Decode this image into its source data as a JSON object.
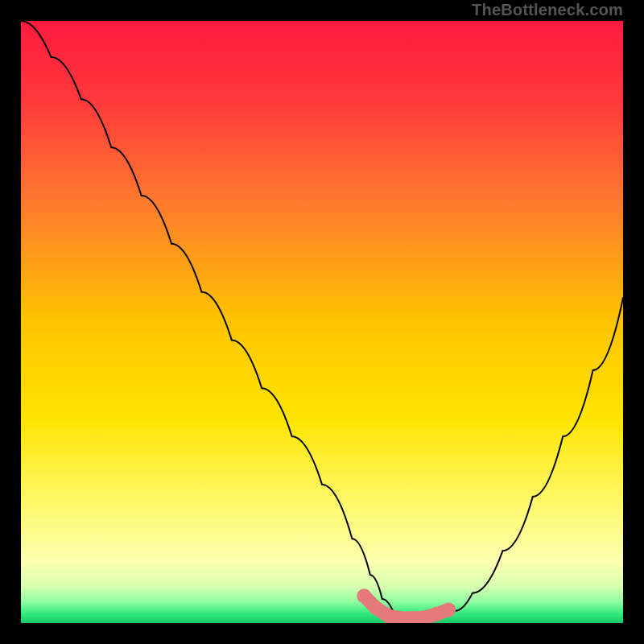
{
  "attribution": "TheBottleneck.com",
  "colors": {
    "frame": "#000000",
    "gradient_stops": [
      {
        "offset": 0,
        "color": "#ff1a3e"
      },
      {
        "offset": 0.14,
        "color": "#ff3b3b"
      },
      {
        "offset": 0.3,
        "color": "#ff7a2e"
      },
      {
        "offset": 0.5,
        "color": "#ffc400"
      },
      {
        "offset": 0.66,
        "color": "#ffe400"
      },
      {
        "offset": 0.8,
        "color": "#fff96a"
      },
      {
        "offset": 0.9,
        "color": "#fbffb0"
      },
      {
        "offset": 0.94,
        "color": "#d7ffb0"
      },
      {
        "offset": 0.965,
        "color": "#8effa0"
      },
      {
        "offset": 0.985,
        "color": "#30e87a"
      },
      {
        "offset": 1.0,
        "color": "#18c965"
      }
    ],
    "curve": "#000000",
    "marker": "#e67a7a"
  },
  "chart_data": {
    "type": "line",
    "title": "",
    "xlabel": "",
    "ylabel": "",
    "ylim": [
      0,
      100
    ],
    "xlim": [
      0,
      100
    ],
    "series": [
      {
        "name": "bottleneck-curve",
        "x": [
          0,
          5,
          10,
          15,
          20,
          25,
          30,
          35,
          40,
          45,
          50,
          55,
          58,
          60,
          62,
          65,
          68,
          70,
          72,
          75,
          80,
          85,
          90,
          95,
          100
        ],
        "y": [
          100,
          94,
          87,
          79,
          71,
          63,
          55,
          47,
          39,
          31,
          23,
          14,
          8,
          4,
          1.5,
          0.5,
          0.5,
          1,
          2,
          5,
          12,
          21,
          31,
          42,
          54
        ]
      }
    ],
    "markers": {
      "name": "optimal-range",
      "x": [
        57,
        59,
        61,
        63,
        65,
        67,
        69,
        71
      ],
      "y": [
        4.5,
        2.5,
        1.2,
        0.8,
        0.8,
        0.9,
        1.5,
        2.2
      ]
    }
  }
}
